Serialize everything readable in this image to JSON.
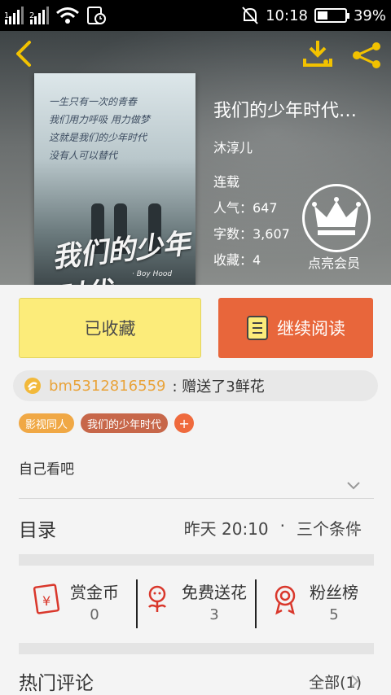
{
  "status_bar": {
    "sim1": "1",
    "sim2": "2",
    "time": "10:18",
    "battery_percent": "39%",
    "battery_level": 0.39
  },
  "book": {
    "title": "我们的少年时代…",
    "author": "沐淳儿",
    "status": "连载",
    "popularity": "人气：647",
    "word_count": "字数：3,607",
    "favorites": "收藏：4"
  },
  "cover": {
    "lines": [
      "一生只有一次的青春",
      "我们用力呼吸 用力做梦",
      "这就是我们的少年时代",
      "没有人可以替代"
    ],
    "title_art": "我们的少年时代",
    "subtitle": "· Boy Hood"
  },
  "vip": {
    "label": "点亮会员"
  },
  "actions": {
    "fav_label": "已收藏",
    "read_label": "继续阅读"
  },
  "gift": {
    "user": "bm5312816559",
    "message": ": 赠送了3鲜花"
  },
  "tags": [
    "影视同人",
    "我们的少年时代"
  ],
  "tag_add": "+",
  "description": "自己看吧",
  "toc": {
    "label": "目录",
    "updated": "昨天 20:10",
    "dot": "·",
    "latest_chapter": "三个条件"
  },
  "rewards": [
    {
      "label": "赏金币",
      "value": "0"
    },
    {
      "label": "免费送花",
      "value": "3"
    },
    {
      "label": "粉丝榜",
      "value": "5"
    }
  ],
  "comments": {
    "label": "热门评论",
    "all": "全部(1)"
  },
  "colors": {
    "fav_bg": "#fcec7a",
    "read_bg": "#e8663b",
    "accent_yellow": "#f2c200",
    "gift_user": "#e9a33a",
    "reward_red": "#d9372b"
  }
}
